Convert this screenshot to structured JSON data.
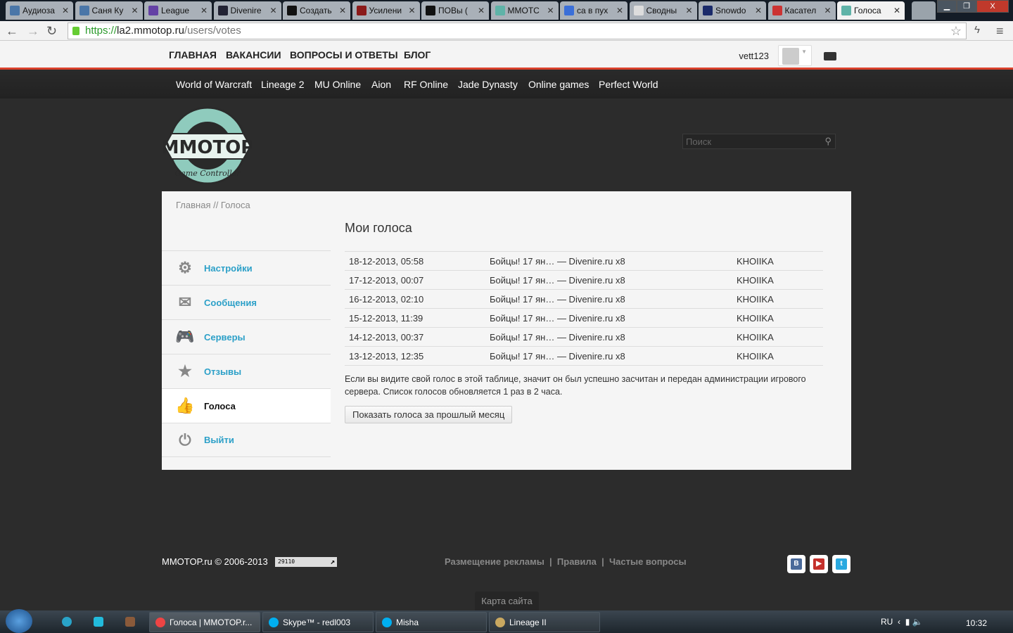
{
  "browser": {
    "tabs": [
      {
        "title": "Аудиоза",
        "color": "#4a76a8"
      },
      {
        "title": "Саня Ку",
        "color": "#4a76a8"
      },
      {
        "title": "League",
        "color": "#6441a5"
      },
      {
        "title": "Divenire",
        "color": "#223"
      },
      {
        "title": "Создать",
        "color": "#111"
      },
      {
        "title": "Усилени",
        "color": "#8b1a1a"
      },
      {
        "title": "ПОВы (",
        "color": "#111"
      },
      {
        "title": "MMOTC",
        "color": "#5fb3a8"
      },
      {
        "title": "са в пух",
        "color": "#3b6fd8"
      },
      {
        "title": "Сводны",
        "color": "#ddd"
      },
      {
        "title": "Snowdo",
        "color": "#1a2a6a"
      },
      {
        "title": "Касател",
        "color": "#c33"
      },
      {
        "title": "Голоса",
        "color": "#5fb3a8"
      }
    ],
    "close_glyph": "✕",
    "url_scheme": "https://",
    "url_host": "la2.mmotop.ru",
    "url_path": "/users/votes",
    "win_min": "▁",
    "win_max": "❐",
    "win_close": "X"
  },
  "site": {
    "top_nav": [
      "ГЛАВНАЯ",
      "ВАКАНСИИ",
      "ВОПРОСЫ И ОТВЕТЫ",
      "БЛОГ"
    ],
    "username": "vett123",
    "game_nav": [
      "World of Warcraft",
      "Lineage 2",
      "MU Online",
      "Aion",
      "RF Online",
      "Jade Dynasty",
      "Online games",
      "Perfect World"
    ],
    "logo_text": "MMOTOP Game Controller",
    "search_placeholder": "Поиск",
    "breadcrumb": "Главная // Голоса",
    "page_title": "Мои голоса",
    "sidebar": [
      {
        "label": "Настройки",
        "icon": "⚙"
      },
      {
        "label": "Сообщения",
        "icon": "✉"
      },
      {
        "label": "Серверы",
        "icon": "🎮"
      },
      {
        "label": "Отзывы",
        "icon": "★"
      },
      {
        "label": "Голоса",
        "icon": "👍"
      },
      {
        "label": "Выйти",
        "icon": "⏻"
      }
    ],
    "votes": [
      {
        "date": "18-12-2013, 05:58",
        "server": "Бойцы! 17 ян… — Divenire.ru x8",
        "char": "KHOIIKA"
      },
      {
        "date": "17-12-2013, 00:07",
        "server": "Бойцы! 17 ян… — Divenire.ru x8",
        "char": "KHOIIKA"
      },
      {
        "date": "16-12-2013, 02:10",
        "server": "Бойцы! 17 ян… — Divenire.ru x8",
        "char": "KHOIIKA"
      },
      {
        "date": "15-12-2013, 11:39",
        "server": "Бойцы! 17 ян… — Divenire.ru x8",
        "char": "KHOIIKA"
      },
      {
        "date": "14-12-2013, 00:37",
        "server": "Бойцы! 17 ян… — Divenire.ru x8",
        "char": "KHOIIKA"
      },
      {
        "date": "13-12-2013, 12:35",
        "server": "Бойцы! 17 ян… — Divenire.ru x8",
        "char": "KHOIIKA"
      }
    ],
    "note": "Если вы видите свой голос в этой таблице, значит он был успешно засчитан и передан администрации игрового сервера. Список голосов обновляется 1 раз в 2 часа.",
    "prev_month_button": "Показать голоса за прошлый месяц",
    "footer": {
      "copyright": "MMOTOP.ru © 2006-2013",
      "counter": "29110",
      "links": [
        "Размещение рекламы",
        "Правила",
        "Частые вопросы"
      ],
      "separator": "|",
      "social": [
        {
          "label": "B",
          "color": "#4a6a9a"
        },
        {
          "label": "▶",
          "color": "#c4302b"
        },
        {
          "label": "t",
          "color": "#2aa9e0"
        }
      ],
      "sitemap": "Карта сайта"
    }
  },
  "taskbar": {
    "items": [
      {
        "label": "Голоса | MMOTOP.r...",
        "color": "#e44"
      },
      {
        "label": "Skype™ - redl003",
        "color": "#00aff0"
      },
      {
        "label": "Misha",
        "color": "#00aff0"
      },
      {
        "label": "Lineage II",
        "color": "#c9a860"
      }
    ],
    "lang": "RU",
    "clock": "10:32"
  }
}
